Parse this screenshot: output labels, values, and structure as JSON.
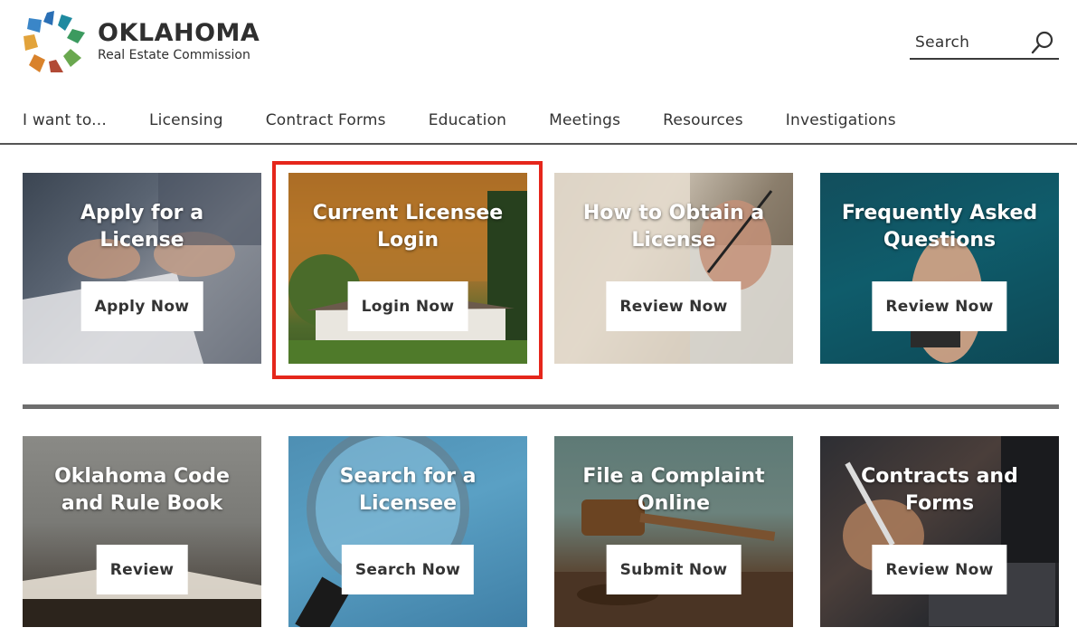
{
  "header": {
    "logo_title": "OKLAHOMA",
    "logo_subtitle": "Real Estate Commission",
    "search_label": "Search"
  },
  "nav": {
    "items": [
      {
        "label": "I want to..."
      },
      {
        "label": "Licensing"
      },
      {
        "label": "Contract Forms"
      },
      {
        "label": "Education"
      },
      {
        "label": "Meetings"
      },
      {
        "label": "Resources"
      },
      {
        "label": "Investigations"
      }
    ]
  },
  "tiles": [
    {
      "title": "Apply for a License",
      "button": "Apply Now"
    },
    {
      "title": "Current Licensee Login",
      "button": "Login Now"
    },
    {
      "title": "How to Obtain a License",
      "button": "Review Now"
    },
    {
      "title": "Frequently Asked Questions",
      "button": "Review Now"
    },
    {
      "title": "Oklahoma Code and Rule Book",
      "button": "Review"
    },
    {
      "title": "Search for a Licensee",
      "button": "Search Now"
    },
    {
      "title": "File a Complaint Online",
      "button": "Submit Now"
    },
    {
      "title": "Contracts and Forms",
      "button": "Review Now"
    }
  ],
  "colors": {
    "highlight": "#e5261b",
    "logo_blue": "#2a6fb5",
    "logo_green": "#3c9a5f",
    "logo_orange": "#d9822b",
    "logo_red": "#b24a36",
    "logo_teal": "#1f8aa0"
  }
}
